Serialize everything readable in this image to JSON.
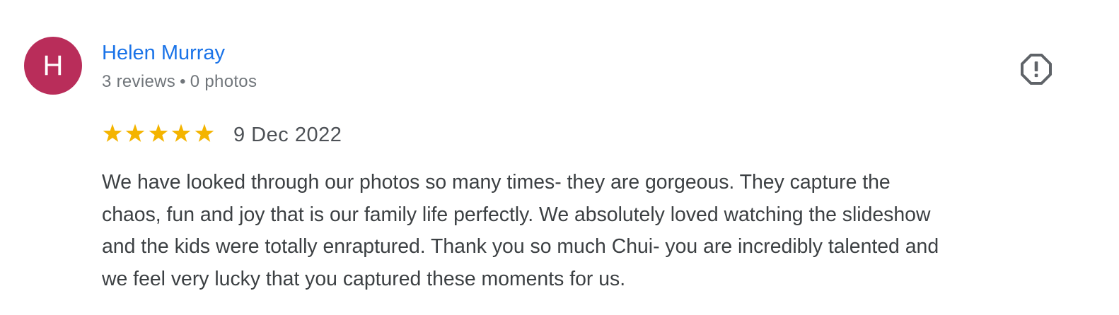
{
  "review": {
    "avatar_initial": "H",
    "reviewer_name": "Helen Murray",
    "reviews_count": "3 reviews",
    "separator": "•",
    "photos_count": "0 photos",
    "rating": 5,
    "rating_max": 5,
    "date": "9 Dec 2022",
    "text_lines": [
      "We have looked through our photos so many times- they are gorgeous. They capture the",
      "chaos, fun and joy that is our family life perfectly. We absolutely loved watching the slideshow",
      "and the kids were totally enraptured. Thank you so much Chui- you are incredibly talented and",
      "we feel very lucky that you captured these moments for us."
    ],
    "report_icon": "report-flag-icon"
  },
  "colors": {
    "avatar_bg": "#b92d5a",
    "name_link": "#1a73e8",
    "meta_text": "#70757a",
    "star": "#f4b400",
    "body_text": "#3c4043",
    "icon": "#5f6368"
  }
}
